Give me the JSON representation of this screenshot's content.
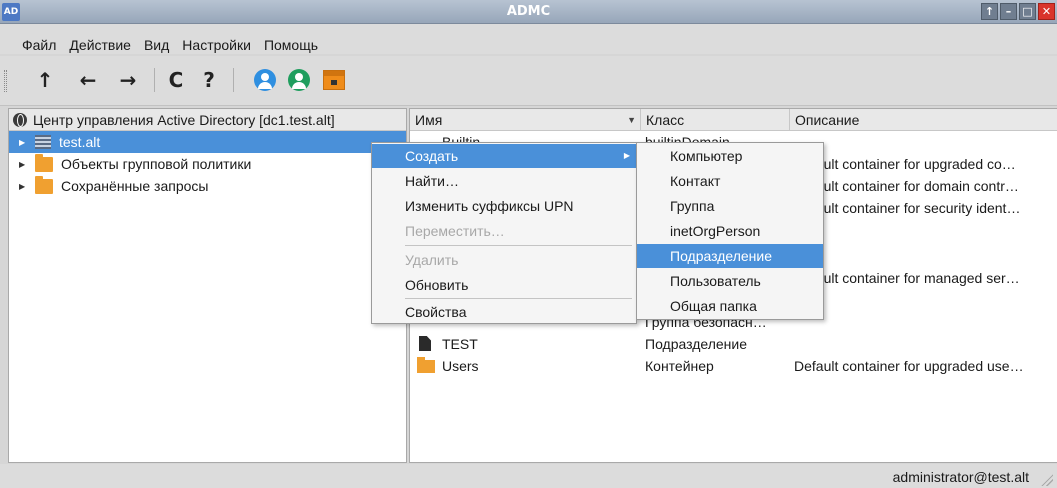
{
  "window": {
    "title": "ADMC",
    "app_icon_text": "AD",
    "controls": [
      "↑",
      "–",
      "□",
      "✕"
    ]
  },
  "menubar": [
    "Файл",
    "Действие",
    "Вид",
    "Настройки",
    "Помощь"
  ],
  "toolbar": {
    "icons": [
      "arrow-up-icon",
      "arrow-left-icon",
      "arrow-right-icon",
      "refresh-icon",
      "help-icon",
      "user-blue-icon",
      "user-green-icon",
      "archive-icon"
    ],
    "glyphs": {
      "up": "↑",
      "back": "←",
      "forward": "→",
      "refresh": "C",
      "help": "?"
    }
  },
  "tree": {
    "root": "Центр управления Active Directory [dc1.test.alt]",
    "items": [
      {
        "label": "test.alt",
        "icon": "domain-icon",
        "selected": true
      },
      {
        "label": "Объекты групповой политики",
        "icon": "folder-icon",
        "selected": false
      },
      {
        "label": "Сохранённые запросы",
        "icon": "folder-icon",
        "selected": false
      }
    ]
  },
  "objects": {
    "columns": [
      "Имя",
      "Класс",
      "Описание"
    ],
    "sort_indicator": "▼",
    "rows": [
      {
        "name": "Builtin",
        "class": "builtinDomain",
        "desc": ""
      },
      {
        "name": "",
        "class": "",
        "desc": "Default container for upgraded co…"
      },
      {
        "name": "",
        "class": "",
        "desc": "Default container for domain contr…"
      },
      {
        "name": "",
        "class": "",
        "desc": "Default container for security ident…"
      },
      {
        "name": "",
        "class": "",
        "desc": "Default container for managed ser…"
      },
      {
        "name": "",
        "class": "Группа безопасн…",
        "desc": ""
      },
      {
        "name": "TEST",
        "class": "Подразделение",
        "desc": ""
      },
      {
        "name": "Users",
        "class": "Контейнер",
        "desc": "Default container for upgraded use…"
      }
    ]
  },
  "context_menu": {
    "items": [
      {
        "label": "Создать",
        "state": "active",
        "submenu": "▶"
      },
      {
        "label": "Найти…",
        "state": "normal"
      },
      {
        "label": "Изменить суффиксы UPN",
        "state": "normal"
      },
      {
        "label": "Переместить…",
        "state": "disabled"
      },
      {
        "label": "Удалить",
        "state": "disabled"
      },
      {
        "label": "Обновить",
        "state": "normal"
      },
      {
        "label": "Свойства",
        "state": "normal"
      }
    ]
  },
  "submenu": {
    "items": [
      {
        "label": "Компьютер",
        "state": "normal"
      },
      {
        "label": "Контакт",
        "state": "normal"
      },
      {
        "label": "Группа",
        "state": "normal"
      },
      {
        "label": "inetOrgPerson",
        "state": "normal"
      },
      {
        "label": "Подразделение",
        "state": "active"
      },
      {
        "label": "Пользователь",
        "state": "normal"
      },
      {
        "label": "Общая папка",
        "state": "normal"
      }
    ]
  },
  "status": {
    "user": "administrator@test.alt"
  }
}
